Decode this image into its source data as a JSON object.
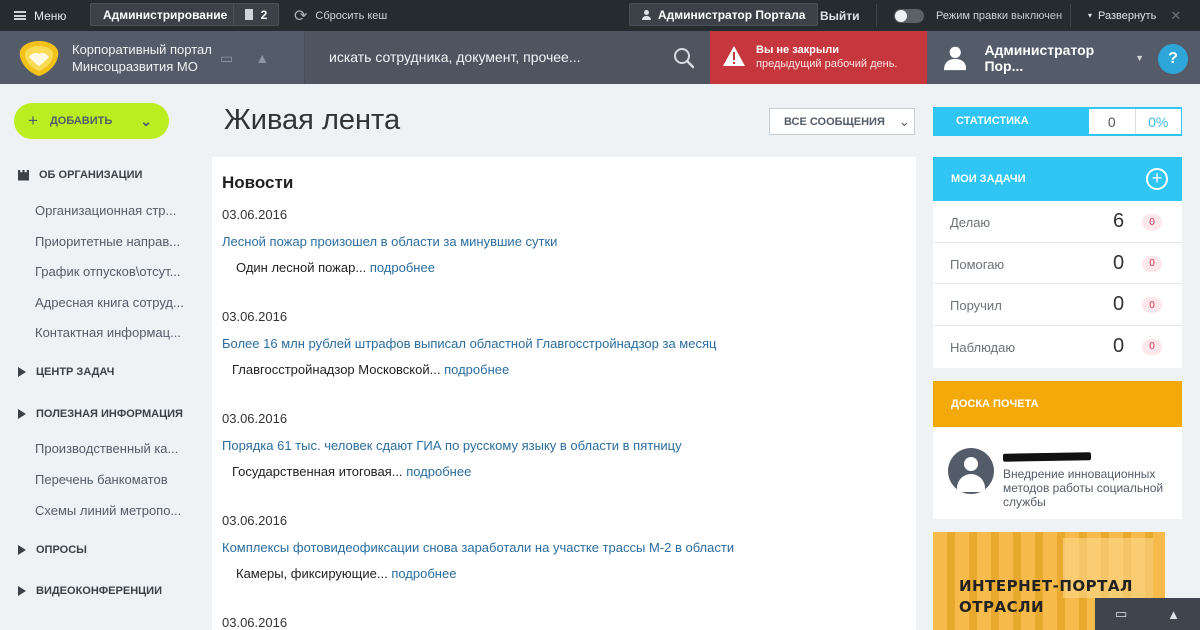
{
  "adminbar": {
    "menu_label": "Меню",
    "admin_label": "Администрирование",
    "flag_count": "2",
    "reset_cache_label": "Сбросить кеш",
    "user_label": "Администратор Портала",
    "logout_label": "Выйти",
    "edit_mode_label": "Режим правки",
    "edit_mode_state": "выключен",
    "expand_label": "Развернуть"
  },
  "header": {
    "portal_line1": "Корпоративный портал",
    "portal_line2": "Минсоцразвития МО",
    "search_placeholder": "искать сотрудника, документ, прочее...",
    "alert_line1": "Вы не закрыли",
    "alert_line2": "предыдущий рабочий день.",
    "user_name": "Администратор Пор...",
    "help_label": "?"
  },
  "sidebar": {
    "add_label": "ДОБАВИТЬ",
    "sections": [
      {
        "label": "ОБ ОРГАНИЗАЦИИ"
      },
      {
        "label": "ЦЕНТР ЗАДАЧ"
      },
      {
        "label": "ПОЛЕЗНАЯ ИНФОРМАЦИЯ"
      },
      {
        "label": "ОПРОСЫ"
      },
      {
        "label": "ВИДЕОКОНФЕРЕНЦИИ"
      }
    ],
    "items": [
      {
        "label": "Организационная стр..."
      },
      {
        "label": "Приоритетные направ..."
      },
      {
        "label": "График отпусков\\отсут..."
      },
      {
        "label": "Адресная книга сотруд..."
      },
      {
        "label": "Контактная информац..."
      },
      {
        "label": "Производственный ка..."
      },
      {
        "label": "Перечень банкоматов"
      },
      {
        "label": "Схемы линий метропо..."
      }
    ]
  },
  "main": {
    "title": "Живая лента",
    "filter_label": "ВСЕ СООБЩЕНИЯ",
    "news_heading": "Новости",
    "more_label": "подробнее",
    "news": [
      {
        "date": "03.06.2016",
        "title": "Лесной пожар произошел в области за минувшие сутки",
        "excerpt": "Один лесной пожар..."
      },
      {
        "date": "03.06.2016",
        "title": "Более 16 млн рублей штрафов выписал областной Главгосстройнадзор за месяц",
        "excerpt": "Главгосстройнадзор Московской..."
      },
      {
        "date": "03.06.2016",
        "title": "Порядка 61 тыс. человек сдают ГИА по русскому языку в области в пятницу",
        "excerpt": "Государственная итоговая..."
      },
      {
        "date": "03.06.2016",
        "title": "Комплексы фотовидеофиксации снова заработали на участке трассы М-2 в области",
        "excerpt": "Камеры, фиксирующие..."
      },
      {
        "date": "03.06.2016",
        "title": "",
        "excerpt": ""
      }
    ]
  },
  "right": {
    "stat_label": "СТАТИСТИКА",
    "stat_value": "0",
    "stat_percent": "0%",
    "tasks_label": "МОИ ЗАДАЧИ",
    "tasks": [
      {
        "name": "Делаю",
        "count": "6",
        "badge": "0"
      },
      {
        "name": "Помогаю",
        "count": "0",
        "badge": "0"
      },
      {
        "name": "Поручил",
        "count": "0",
        "badge": "0"
      },
      {
        "name": "Наблюдаю",
        "count": "0",
        "badge": "0"
      }
    ],
    "honor_label": "ДОСКА ПОЧЕТА",
    "honor_text": "Внедрение инновационных методов работы социальной службы",
    "banner_line1": "ИНТЕРНЕТ-ПОРТАЛ",
    "banner_line2": "ОТРАСЛИ"
  },
  "colors": {
    "accent": "#30c5f5",
    "add_button": "#bbed21",
    "alert": "#c6373d",
    "honor": "#f4a90b",
    "header": "#545c6a",
    "link": "#2b6d9f"
  }
}
